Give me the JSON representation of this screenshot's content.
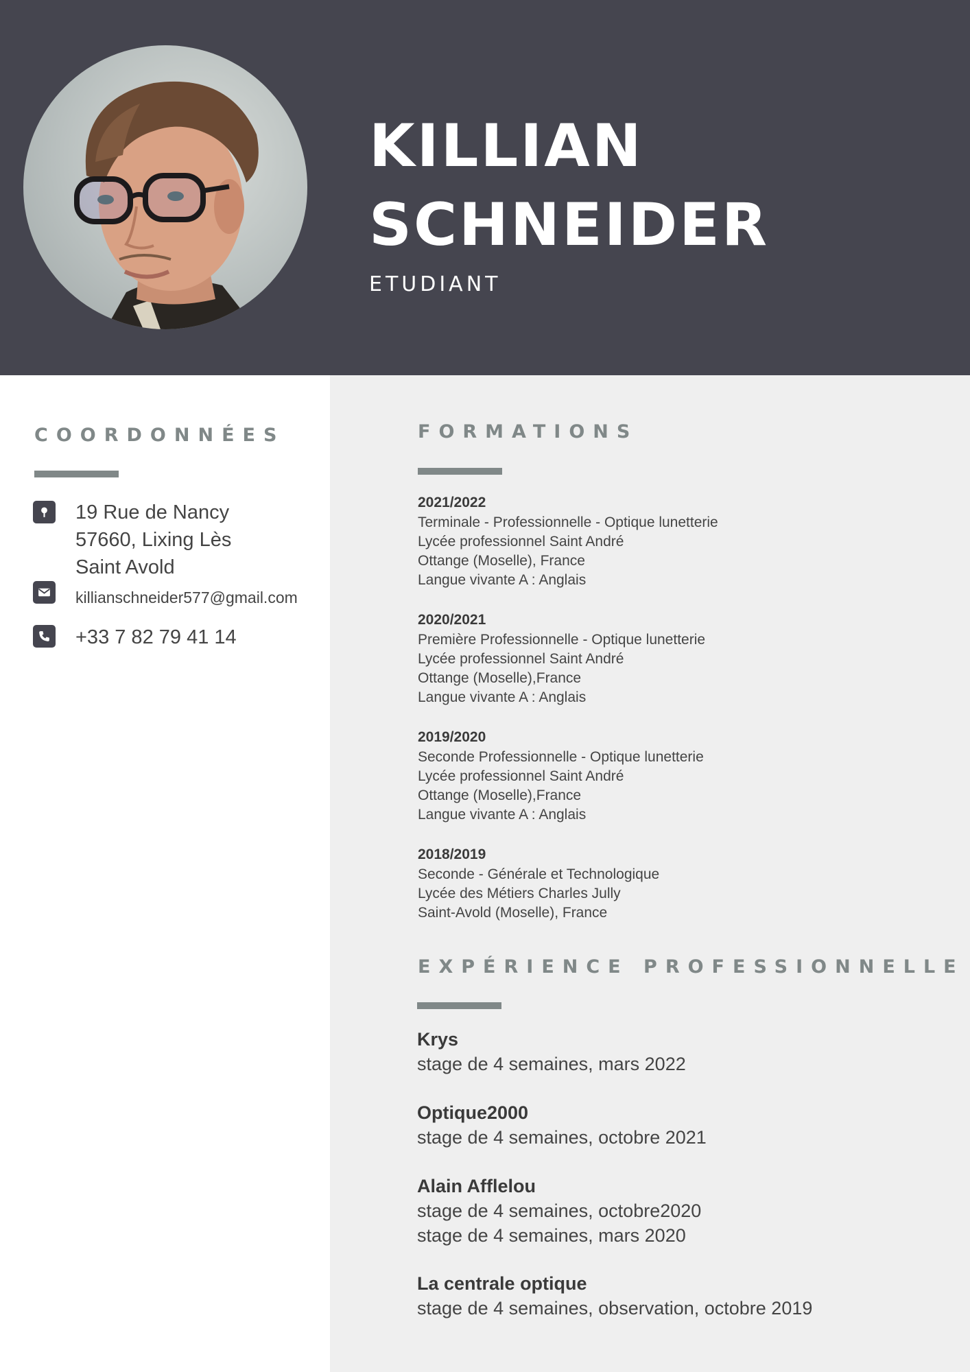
{
  "header": {
    "first_name": "KILLIAN",
    "last_name": "SCHNEIDER",
    "job_title": "ETUDIANT",
    "background_color": "#45454f"
  },
  "contact": {
    "title": "COORDONNÉES",
    "address_icon": "location-pin-icon",
    "address_lines": [
      "19 Rue de Nancy",
      "57660, Lixing Lès",
      "Saint Avold"
    ],
    "email_icon": "envelope-icon",
    "email": "killianschneider577@gmail.com",
    "phone_icon": "phone-icon",
    "phone": "+33 7 82 79 41 14"
  },
  "formations": {
    "title": "FORMATIONS",
    "items": [
      {
        "year": "2021/2022",
        "lines": [
          "Terminale - Professionnelle - Optique lunetterie",
          "Lycée professionnel Saint André",
          "Ottange (Moselle), France",
          "Langue vivante A : Anglais"
        ]
      },
      {
        "year": "2020/2021",
        "lines": [
          "Première Professionnelle - Optique lunetterie",
          "Lycée professionnel Saint André",
          "Ottange (Moselle),France",
          "Langue vivante A : Anglais"
        ]
      },
      {
        "year": "2019/2020",
        "lines": [
          "Seconde Professionnelle - Optique lunetterie",
          "Lycée professionnel Saint André",
          "Ottange (Moselle),France",
          "Langue vivante A : Anglais"
        ]
      },
      {
        "year": "2018/2019",
        "lines": [
          "Seconde - Générale et Technologique",
          "Lycée des Métiers Charles Jully",
          "Saint-Avold (Moselle), France"
        ]
      }
    ]
  },
  "experience": {
    "title": "EXPÉRIENCE PROFESSIONNELLE",
    "items": [
      {
        "company": "Krys",
        "lines": [
          "stage de 4 semaines, mars 2022"
        ]
      },
      {
        "company": "Optique2000",
        "lines": [
          "stage de 4 semaines, octobre 2021"
        ]
      },
      {
        "company": "Alain Afflelou",
        "lines": [
          "stage de 4 semaines, octobre2020",
          "stage de 4 semaines, mars 2020"
        ]
      },
      {
        "company": "La centrale optique",
        "lines": [
          "stage de 4 semaines, observation, octobre 2019"
        ]
      }
    ]
  },
  "colors": {
    "header_bg": "#45454f",
    "accent_grey": "#808888",
    "right_column_bg": "#efefef"
  }
}
